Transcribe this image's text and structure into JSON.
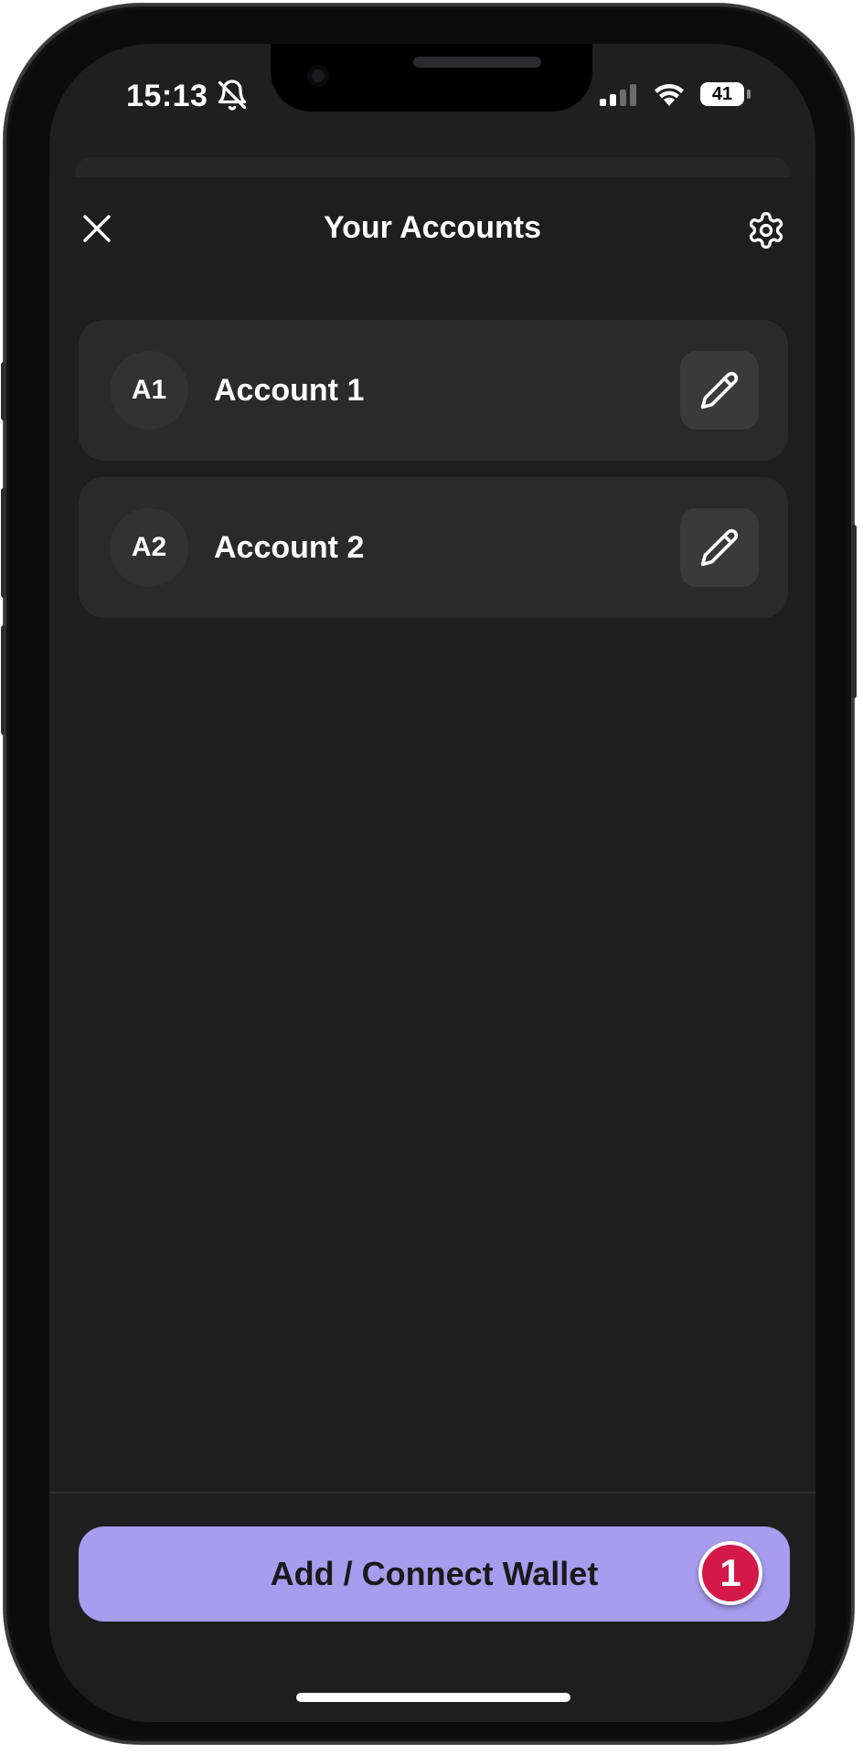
{
  "status_bar": {
    "time": "15:13",
    "battery": "41",
    "icons": [
      "bell-slash-icon",
      "signal-icon",
      "wifi-icon",
      "battery-icon"
    ]
  },
  "header": {
    "title": "Your Accounts",
    "close_icon": "close-icon",
    "settings_icon": "gear-icon"
  },
  "accounts": [
    {
      "initials": "A1",
      "name": "Account 1",
      "edit_icon": "pencil-icon"
    },
    {
      "initials": "A2",
      "name": "Account 2",
      "edit_icon": "pencil-icon"
    }
  ],
  "footer": {
    "cta_label": "Add / Connect Wallet",
    "step_badge": "1"
  },
  "colors": {
    "background": "#1e1e1e",
    "card": "#2a2a2a",
    "accent": "#a89cee",
    "badge": "#d4194a"
  }
}
